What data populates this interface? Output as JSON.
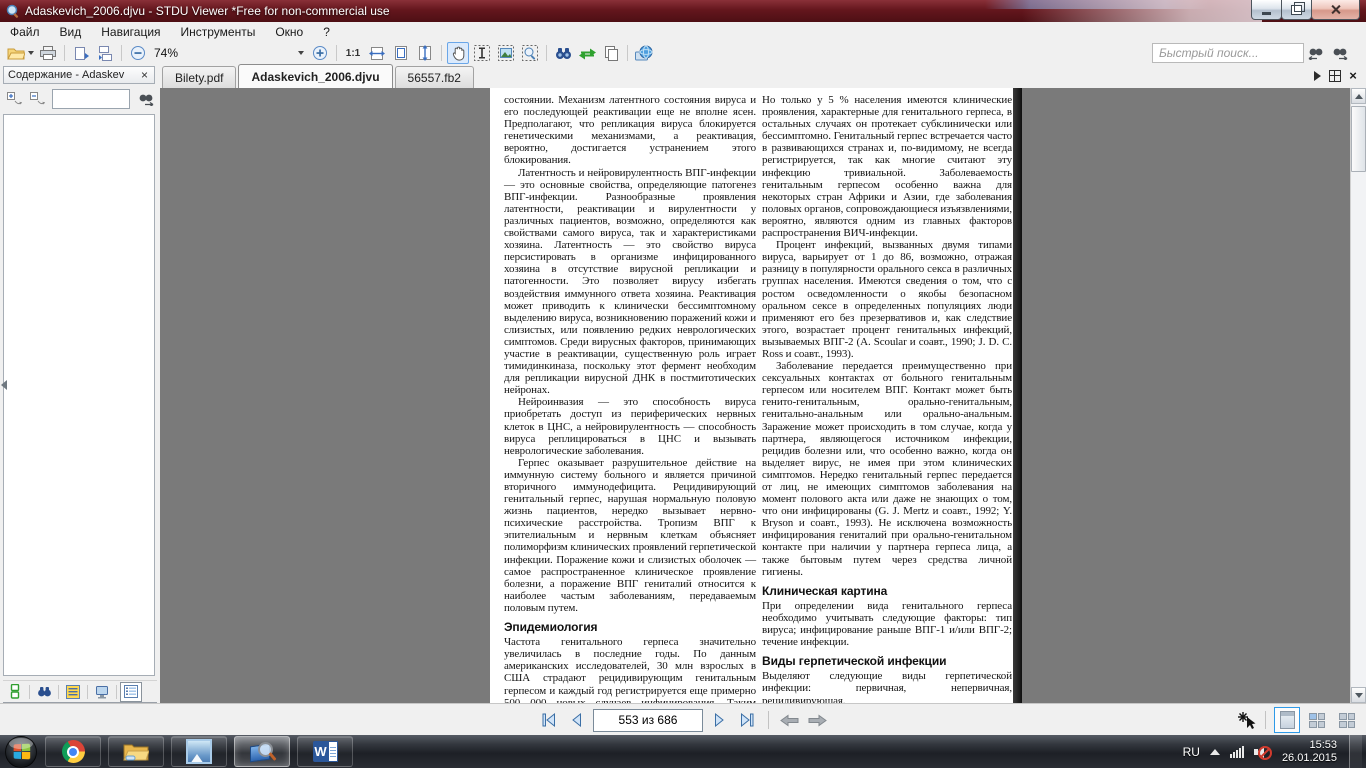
{
  "window": {
    "title": "Adaskevich_2006.djvu - STDU Viewer *Free for non-commercial use"
  },
  "glyphs": {
    "close_x": "×"
  },
  "menu": {
    "items": [
      "Файл",
      "Вид",
      "Навигация",
      "Инструменты",
      "Окно",
      "?"
    ]
  },
  "toolbar": {
    "zoom_value": "74%",
    "actual_size_label": "1:1",
    "search_placeholder": "Быстрый поиск..."
  },
  "sidebar": {
    "title": "Содержание - Adaskev",
    "filter_value": ""
  },
  "tabs": {
    "items": [
      {
        "label": "Bilety.pdf"
      },
      {
        "label": "Adaskevich_2006.djvu"
      },
      {
        "label": "56557.fb2"
      }
    ]
  },
  "document": {
    "left_column": {
      "p1": "состоянии. Механизм латентного состояния вируса и его последующей реактивации еще не вполне ясен. Предполагают, что репликация вируса блокируется генетическими механизмами, а реактивация, вероятно, достигается устранением этого блокирования.",
      "p2": "Латентность и нейровирулентность ВПГ-инфекции — это основные свойства, определяющие патогенез ВПГ-инфекции. Разнообразные проявления латентности, реактивации и вирулентности у различных пациентов, возможно, определяются как свойствами самого вируса, так и характеристиками хозяина. Латентность — это свойство вируса персистировать в организме инфицированного хозяина в отсутствие вирусной репликации и патогенности. Это позволяет вирусу избегать воздействия иммунного ответа хозяина. Реактивация может приводить к клинически бессимптомному выделению вируса, возникновению поражений кожи и слизистых, или появлению редких неврологических симптомов. Среди вирусных факторов, принимающих участие в реактивации, существенную роль играет тимидинкиназа, поскольку этот фермент необходим для репликации вирусной ДНК в постмитотических нейронах.",
      "p3": "Нейроинвазия — это способность вируса приобретать доступ из периферических нервных клеток в ЦНС, а нейровирулентность — способность вируса реплицироваться в ЦНС и вызывать неврологические заболевания.",
      "p4": "Герпес оказывает разрушительное действие на иммунную систему больного и является причиной вторичного иммунодефицита. Рецидивирующий генитальный герпес, нарушая нормальную половую жизнь пациентов, нередко вызывает нервно-психические расстройства. Тропизм ВПГ к эпителиальным и нервным клеткам объясняет полиморфизм клинических проявлений герпетической инфекции. Поражение кожи и слизистых оболочек — самое распространенное клиническое проявление болезни, а поражение ВПГ гениталий относится к наиболее частым заболеваниям, передаваемым половым путем.",
      "h1": "Эпидемиология",
      "p5": "Частота генитального герпеса значительно увеличилась в последние годы. По данным американских исследователей, 30 млн взрослых в США страдают рецидивирующим генитальным герпесом и каждый год регистрируется еще примерно 500 000 новых случаев инфицирования. Таким образом, у каждого пятого жителя США"
    },
    "right_column": {
      "p1": "Но только у 5 % населения имеются клинические проявления, характерные для генитального герпеса, в остальных случаях он протекает субклинически или бессимптомно. Генитальный герпес встречается часто в развивающихся странах и, по-видимому, не всегда регистрируется, так как многие считают эту инфекцию тривиальной. Заболеваемость генитальным герпесом особенно важна для некоторых стран Африки и Азии, где заболевания половых органов, сопровождающиеся изъязвлениями, вероятно, являются одним из главных факторов распространения ВИЧ-инфекции.",
      "p2": "Процент инфекций, вызванных двумя типами вируса, варьирует от 1 до 86, возможно, отражая разницу в популярности орального секса в различных группах населения. Имеются сведения о том, что с ростом осведомленности о якобы безопасном оральном сексе в определенных популяциях люди применяют его без презервативов и, как следствие этого, возрастает процент генитальных инфекций, вызываемых ВПГ-2 (A. Scoular и соавт., 1990; J. D. C. Ross и соавт., 1993).",
      "p3": "Заболевание передается преимущественно при сексуальных контактах от больного генитальным герпесом или носителем ВПГ. Контакт может быть генито-генитальным, орально-генитальным, генитально-анальным или орально-анальным. Заражение может происходить в том случае, когда у партнера, являющегося источником инфекции, рецидив болезни или, что особенно важно, когда он выделяет вирус, не имея при этом клинических симптомов. Нередко генитальный герпес передается от лиц, не имеющих симптомов заболевания на момент полового акта или даже не знающих о том, что они инфицированы (G. J. Mertz и соавт., 1992; Y. Bryson и соавт., 1993). Не исключена возможность инфицирования гениталий при орально-генитальном контакте при наличии у партнера герпеса лица, а также бытовым путем через средства личной гигиены.",
      "h1": "Клиническая картина",
      "p4": "При определении вида генитального герпеса необходимо учитывать следующие факторы: тип вируса; инфицирование раньше ВПГ-1 и/или ВПГ-2; течение инфекции.",
      "h2": "Виды герпетической инфекции",
      "p5": "Выделяют следующие виды герпетической инфекции: первичная, непервичная, рецидивирующая."
    }
  },
  "statusbar": {
    "page_field": "553 из 686"
  },
  "taskbar": {
    "tray": {
      "language": "RU",
      "time": "15:53",
      "date": "26.01.2015"
    }
  }
}
